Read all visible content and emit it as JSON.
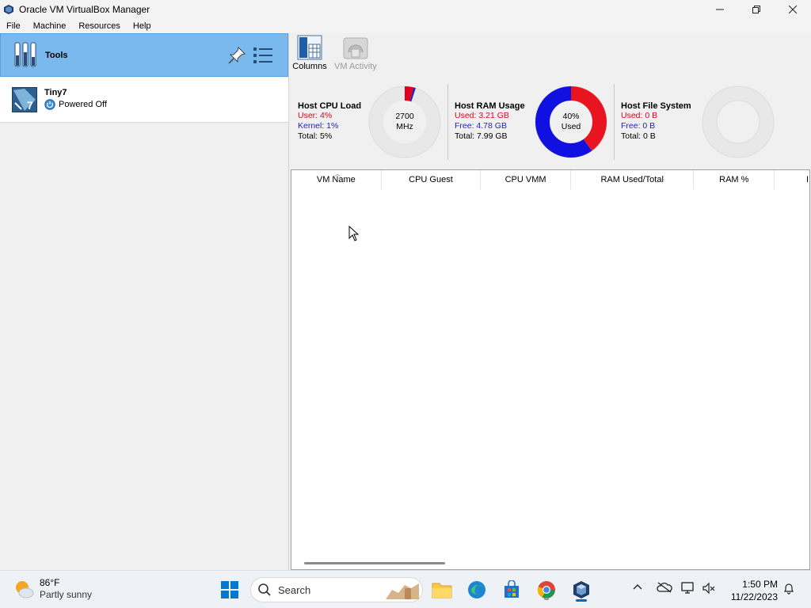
{
  "window": {
    "title": "Oracle VM VirtualBox Manager",
    "controls": {
      "minimize": "—",
      "restore": "❐",
      "close": "✕"
    }
  },
  "menu": [
    "File",
    "Machine",
    "Resources",
    "Help"
  ],
  "sidebar": {
    "tools_label": "Tools",
    "vms": [
      {
        "name": "Tiny7",
        "state": "Powered Off"
      }
    ]
  },
  "toolbar": {
    "columns_label": "Columns",
    "activity_label": "VM Activity"
  },
  "stats": {
    "cpu": {
      "title": "Host CPU Load",
      "user": "User: 4%",
      "kernel": "Kernel: 1%",
      "total": "Total: 5%",
      "center_line1": "2700",
      "center_line2": "MHz",
      "user_pct": 4,
      "kernel_pct": 1
    },
    "ram": {
      "title": "Host RAM Usage",
      "used": "Used: 3.21 GB",
      "free": "Free: 4.78 GB",
      "total": "Total: 7.99 GB",
      "center_line1": "40%",
      "center_line2": "Used",
      "used_pct": 40
    },
    "fs": {
      "title": "Host File System",
      "used": "Used: 0 B",
      "free": "Free: 0 B",
      "total": "Total: 0 B"
    }
  },
  "table": {
    "columns": [
      "VM Name",
      "CPU Guest",
      "CPU VMM",
      "RAM Used/Total",
      "RAM %",
      "I"
    ]
  },
  "taskbar": {
    "weather_temp": "86°F",
    "weather_cond": "Partly sunny",
    "search_label": "Search",
    "time": "1:50 PM",
    "date": "11/22/2023"
  },
  "colors": {
    "selection": "#7ab9ed",
    "cpu_user": "#e0001b",
    "cpu_kernel": "#2020c0",
    "ram_used": "#e8141f",
    "ram_free": "#1010e0",
    "ring_bg": "#e8e8e8"
  }
}
